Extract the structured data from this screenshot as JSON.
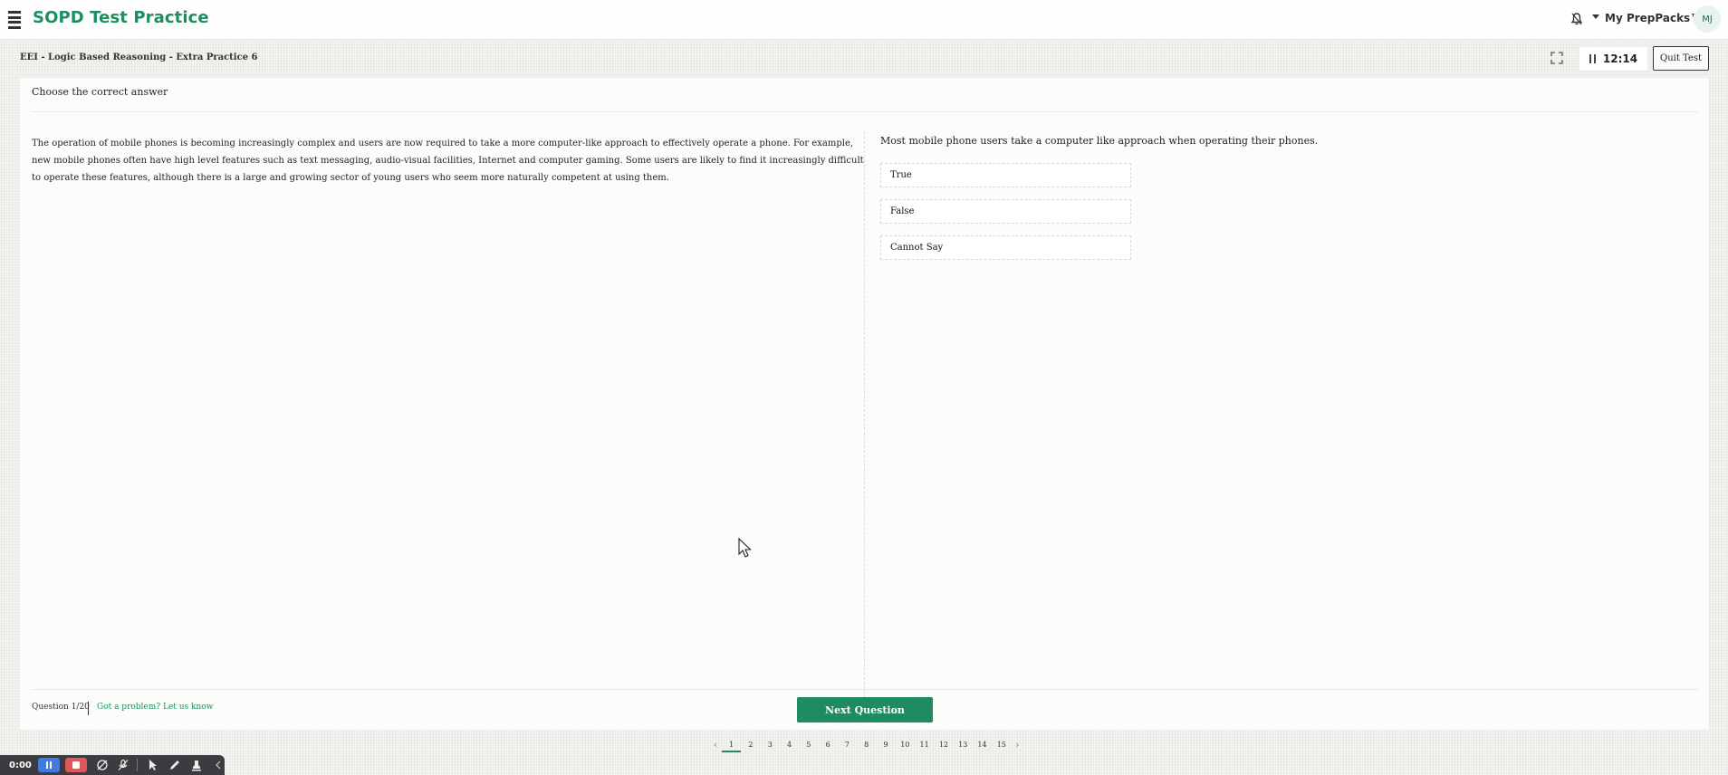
{
  "app": {
    "title": "SOPD Test Practice",
    "brand_color": "#1d8f5f",
    "menu_icon": "hamburger-icon",
    "notifications_icon": "bell-icon",
    "prep_packs_label": "My PrepPacks™",
    "avatar_initials": "MJ"
  },
  "test": {
    "title": "EEI - Logic Based Reasoning - Extra Practice 6",
    "timer": "12:14",
    "quit_label": "Quit Test",
    "instruction": "Choose the correct answer",
    "passage": "The operation of mobile phones is becoming increasingly complex and users are now required to take a more computer-like approach to effectively operate a phone. For example, new mobile phones often have high level features such as text messaging, audio-visual facilities, Internet and computer gaming. Some users are likely to find it increasingly difficult to operate these features, although there is a large and growing sector of young users who seem more naturally competent at using them.",
    "question": "Most mobile phone users take a computer like approach when operating their phones.",
    "options": [
      {
        "label": "True"
      },
      {
        "label": "False"
      },
      {
        "label": "Cannot Say"
      }
    ],
    "question_counter": "Question 1/20",
    "problem_link": "Got a problem? Let us know",
    "next_label": "Next Question"
  },
  "pagination": {
    "prev_icon": "chevron-left-icon",
    "next_icon": "chevron-right-icon",
    "current": 1,
    "pages": [
      "1",
      "2",
      "3",
      "4",
      "5",
      "6",
      "7",
      "8",
      "9",
      "10",
      "11",
      "12",
      "13",
      "14",
      "15"
    ]
  },
  "recorder": {
    "elapsed": "0:00",
    "pause_color": "#3f7be0",
    "stop_color": "#e0575a"
  }
}
